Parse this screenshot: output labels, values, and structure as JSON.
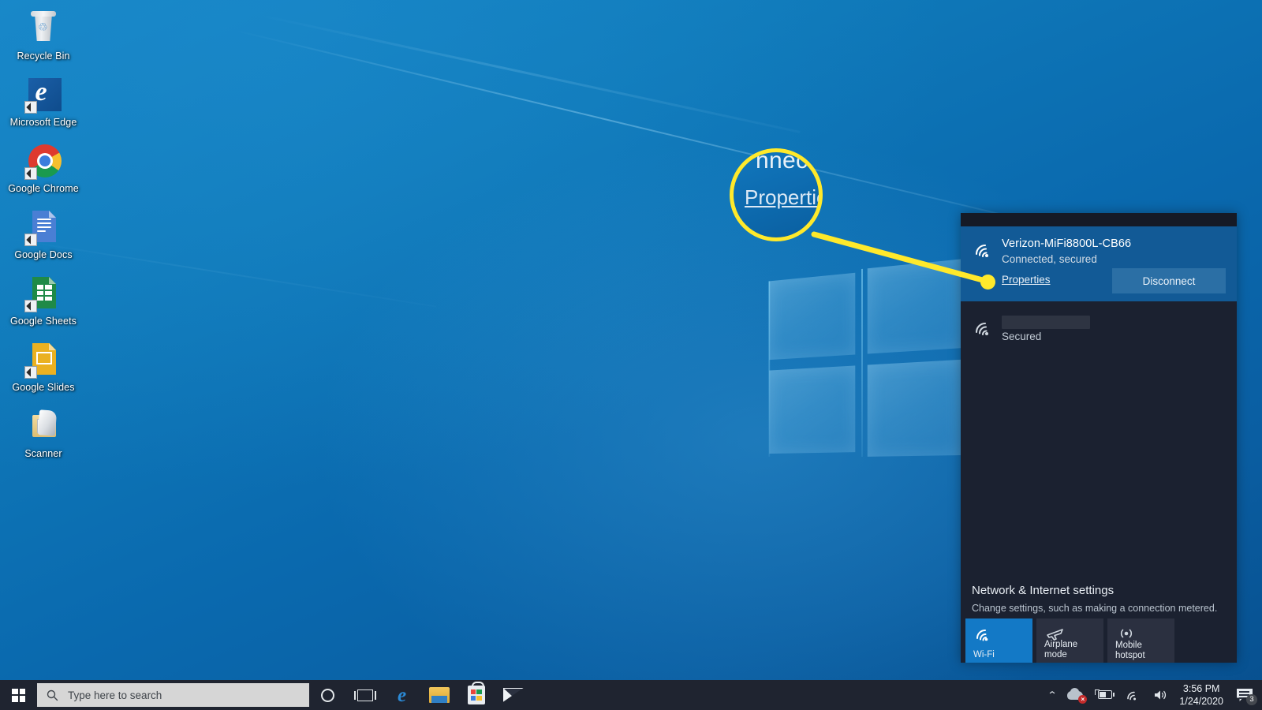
{
  "desktop": {
    "icons": [
      {
        "label": "Recycle Bin",
        "icon": "recycle-bin-icon",
        "shortcut": false
      },
      {
        "label": "Microsoft Edge",
        "icon": "microsoft-edge-icon",
        "shortcut": true
      },
      {
        "label": "Google Chrome",
        "icon": "google-chrome-icon",
        "shortcut": true
      },
      {
        "label": "Google Docs",
        "icon": "google-docs-icon",
        "shortcut": true
      },
      {
        "label": "Google Sheets",
        "icon": "google-sheets-icon",
        "shortcut": true
      },
      {
        "label": "Google Slides",
        "icon": "google-slides-icon",
        "shortcut": true
      },
      {
        "label": "Scanner",
        "icon": "scanner-icon",
        "shortcut": false
      }
    ]
  },
  "network_flyout": {
    "connected_network": {
      "ssid": "Verizon-MiFi8800L-CB66",
      "status": "Connected, secured",
      "properties_link": "Properties",
      "disconnect_label": "Disconnect",
      "icon": "wifi-icon",
      "highlight_color": "#125a96"
    },
    "other_network": {
      "ssid": "",
      "ssid_redacted": true,
      "status": "Secured",
      "icon": "wifi-icon"
    },
    "settings": {
      "title": "Network & Internet settings",
      "subtitle": "Change settings, such as making a connection metered."
    },
    "quick_tiles": [
      {
        "label": "Wi-Fi",
        "icon": "wifi-icon",
        "active": true
      },
      {
        "label": "Airplane mode",
        "icon": "airplane-icon",
        "active": false
      },
      {
        "label": "Mobile hotspot",
        "icon": "hotspot-icon",
        "active": false
      }
    ]
  },
  "annotation": {
    "magnifier_top_text": "nnect",
    "magnifier_main_text": "Properties",
    "highlight_color": "#ffe92b"
  },
  "taskbar": {
    "start": {
      "icon": "windows-logo-icon"
    },
    "search": {
      "placeholder": "Type here to search",
      "icon": "search-icon"
    },
    "buttons": [
      {
        "name": "cortana",
        "icon": "cortana-icon"
      },
      {
        "name": "task-view",
        "icon": "task-view-icon"
      },
      {
        "name": "edge",
        "icon": "microsoft-edge-icon"
      },
      {
        "name": "file-explorer",
        "icon": "file-explorer-icon"
      },
      {
        "name": "microsoft-store",
        "icon": "microsoft-store-icon"
      },
      {
        "name": "mail",
        "icon": "mail-icon"
      }
    ],
    "tray": {
      "chevron": "⌃",
      "onedrive_error": "×",
      "icons": [
        "onedrive-error-icon",
        "battery-charging-icon",
        "wifi-icon",
        "volume-icon"
      ],
      "time": "3:56 PM",
      "date": "1/24/2020",
      "notification_count": "3"
    }
  }
}
